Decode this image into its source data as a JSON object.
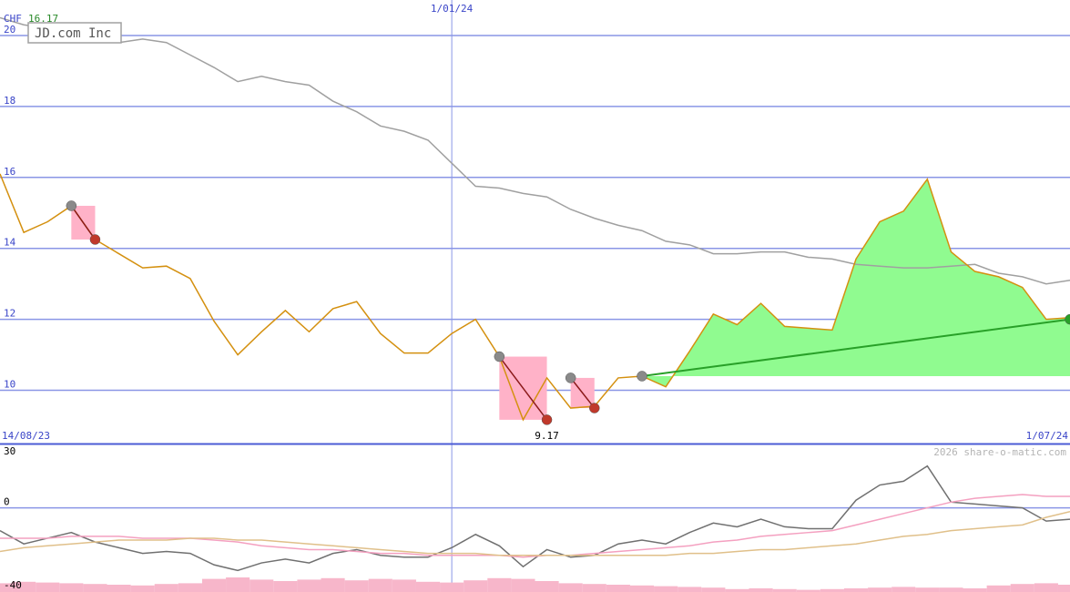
{
  "header": {
    "currency": "CHF",
    "last_price": "16.17",
    "name": "JD.com Inc"
  },
  "footer": {
    "copyright": "2026 share-o-matic.com"
  },
  "colors": {
    "background": "#ffffff",
    "grid": "#8a96e6",
    "axis_label": "#3a45c8",
    "last_price": "#2a8a2a",
    "price_line": "#d4900f",
    "moving_avg": "#a0a0a0",
    "gain_fill": "#90fb90",
    "gain_line": "#28a028",
    "loss_fill": "#ffb2c8",
    "loss_line": "#8b1a1a",
    "peak_marker": "#8a8a8a",
    "trough_marker": "#c0392b",
    "osc_main": "#707070",
    "osc_pink": "#f4a0c0",
    "osc_tan": "#e0c08a",
    "volume": "#f7b6ca"
  },
  "chart_data": [
    {
      "type": "line",
      "title": "JD.com Inc",
      "ylabel": "CHF",
      "ylim": [
        8.5,
        21.0
      ],
      "yticks": [
        10,
        12,
        14,
        16,
        18,
        20
      ],
      "xlim": [
        0,
        45
      ],
      "xticks": [
        {
          "x": 0,
          "label": "14/08/23"
        },
        {
          "x": 19,
          "label": "1/01/24"
        },
        {
          "x": 45,
          "label": "1/07/24"
        }
      ],
      "vline_x": 19,
      "low_label": {
        "x": 23,
        "value": 9.17,
        "label": "9.17"
      },
      "series": [
        {
          "role": "price",
          "values": [
            16.1,
            14.45,
            14.75,
            15.2,
            14.25,
            13.85,
            13.45,
            13.5,
            13.15,
            11.95,
            11.0,
            11.65,
            12.25,
            11.65,
            12.3,
            12.5,
            11.6,
            11.05,
            11.05,
            11.6,
            12.0,
            10.95,
            9.17,
            10.35,
            9.5,
            9.55,
            10.35,
            10.4,
            10.1,
            11.1,
            12.15,
            11.85,
            12.45,
            11.8,
            11.75,
            11.7,
            13.7,
            14.75,
            15.05,
            15.95,
            13.9,
            13.35,
            13.2,
            12.9,
            12.0,
            12.05
          ]
        },
        {
          "role": "moving_average",
          "values": [
            20.5,
            20.3,
            20.2,
            20.0,
            19.85,
            19.8,
            19.9,
            19.8,
            19.45,
            19.1,
            18.7,
            18.85,
            18.7,
            18.6,
            18.15,
            17.85,
            17.45,
            17.3,
            17.05,
            16.4,
            15.75,
            15.7,
            15.55,
            15.45,
            15.1,
            14.85,
            14.65,
            14.5,
            14.2,
            14.1,
            13.85,
            13.85,
            13.9,
            13.9,
            13.75,
            13.7,
            13.55,
            13.5,
            13.45,
            13.45,
            13.5,
            13.55,
            13.3,
            13.2,
            13.0,
            13.1
          ]
        }
      ],
      "markers": [
        {
          "x": 3,
          "value": 15.2,
          "kind": "peak"
        },
        {
          "x": 4,
          "value": 14.25,
          "kind": "trough"
        },
        {
          "x": 21,
          "value": 10.95,
          "kind": "peak"
        },
        {
          "x": 23,
          "value": 9.17,
          "kind": "trough"
        },
        {
          "x": 24,
          "value": 10.35,
          "kind": "peak"
        },
        {
          "x": 25,
          "value": 9.5,
          "kind": "trough"
        },
        {
          "x": 27,
          "value": 10.4,
          "kind": "peak"
        },
        {
          "x": 45,
          "value": 12.0,
          "kind": "end"
        }
      ],
      "loss_zones": [
        {
          "x0": 3,
          "x1": 4,
          "top": 15.2,
          "bottom": 14.25
        },
        {
          "x0": 21,
          "x1": 23,
          "top": 10.95,
          "bottom": 9.17
        },
        {
          "x0": 24,
          "x1": 25,
          "top": 10.35,
          "bottom": 9.5
        }
      ],
      "gain_zone": {
        "x0": 27,
        "x1": 45,
        "base": 10.4
      },
      "trend_line": {
        "x0": 27,
        "y0": 10.4,
        "x1": 45,
        "y1": 12.0
      }
    },
    {
      "type": "line",
      "ylim": [
        -40,
        30
      ],
      "yticks": [
        30,
        0,
        -40
      ],
      "xlim": [
        0,
        45
      ],
      "series": [
        {
          "role": "oscillator",
          "values": [
            -12,
            -19,
            -16,
            -13,
            -18,
            -21,
            -24,
            -23,
            -24,
            -30,
            -33,
            -29,
            -27,
            -29,
            -24,
            -22,
            -25,
            -26,
            -26,
            -21,
            -14,
            -20,
            -31,
            -22,
            -26,
            -25,
            -19,
            -17,
            -19,
            -13,
            -8,
            -10,
            -6,
            -10,
            -11,
            -11,
            4,
            12,
            14,
            22,
            3,
            2,
            1,
            0,
            -7,
            -6
          ]
        },
        {
          "role": "signal_pink",
          "values": [
            -16,
            -16,
            -16,
            -15,
            -15,
            -15,
            -16,
            -16,
            -16,
            -17,
            -18,
            -20,
            -21,
            -22,
            -22,
            -23,
            -24,
            -24,
            -25,
            -25,
            -25,
            -25,
            -26,
            -25,
            -25,
            -24,
            -23,
            -22,
            -21,
            -20,
            -18,
            -17,
            -15,
            -14,
            -13,
            -12,
            -9,
            -6,
            -3,
            0,
            3,
            5,
            6,
            7,
            6,
            6
          ]
        },
        {
          "role": "signal_tan",
          "values": [
            -23,
            -21,
            -20,
            -19,
            -18,
            -17,
            -17,
            -17,
            -16,
            -16,
            -17,
            -17,
            -18,
            -19,
            -20,
            -21,
            -22,
            -23,
            -24,
            -24,
            -24,
            -25,
            -25,
            -25,
            -25,
            -25,
            -25,
            -25,
            -25,
            -24,
            -24,
            -23,
            -22,
            -22,
            -21,
            -20,
            -19,
            -17,
            -15,
            -14,
            -12,
            -11,
            -10,
            -9,
            -5,
            -2
          ]
        }
      ],
      "volume": [
        0.6,
        0.7,
        0.65,
        0.6,
        0.55,
        0.5,
        0.45,
        0.55,
        0.6,
        0.9,
        1.0,
        0.85,
        0.75,
        0.85,
        0.95,
        0.8,
        0.9,
        0.85,
        0.7,
        0.65,
        0.8,
        0.95,
        0.9,
        0.75,
        0.6,
        0.55,
        0.5,
        0.45,
        0.4,
        0.35,
        0.3,
        0.2,
        0.25,
        0.2,
        0.15,
        0.2,
        0.25,
        0.3,
        0.35,
        0.3,
        0.3,
        0.25,
        0.45,
        0.55,
        0.6,
        0.5
      ]
    }
  ]
}
